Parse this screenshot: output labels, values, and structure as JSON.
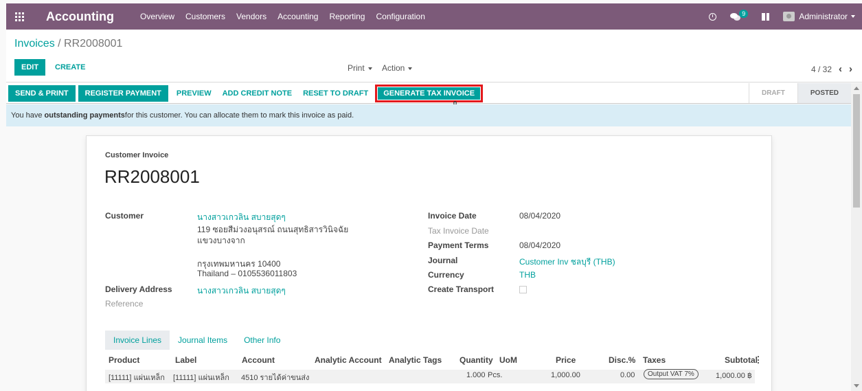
{
  "navbar": {
    "app_title": "Accounting",
    "menu": [
      "Overview",
      "Customers",
      "Vendors",
      "Accounting",
      "Reporting",
      "Configuration"
    ],
    "chat_count": "9",
    "user": "Administrator",
    "bg_color": "#7c5a79"
  },
  "control": {
    "breadcrumb_parent": "Invoices",
    "breadcrumb_sep": " / ",
    "breadcrumb_current": "RR2008001",
    "edit_label": "EDIT",
    "create_label": "CREATE",
    "print_label": "Print",
    "action_label": "Action",
    "pager": "4 / 32"
  },
  "statusbar": {
    "send_print": "SEND & PRINT",
    "register_payment": "REGISTER PAYMENT",
    "preview": "PREVIEW",
    "add_credit_note": "ADD CREDIT NOTE",
    "reset_to_draft": "RESET TO DRAFT",
    "generate_tax_invoice": "GENERATE TAX INVOICE",
    "stages": [
      "DRAFT",
      "POSTED"
    ],
    "active_stage": "POSTED"
  },
  "alert": {
    "prefix": "You have ",
    "bold": "outstanding payments",
    "suffix": " for this customer. You can allocate them to mark this invoice as paid."
  },
  "sheet": {
    "type": "Customer Invoice",
    "number": "RR2008001",
    "customer_label": "Customer",
    "customer_name": "นางสาวเกวลิน สบายสุดๆ",
    "customer_addr1": "119 ซอยสีม่วงอนุสรณ์ ถนนสุทธิสารวินิจฉัย",
    "customer_addr2": "แขวงบางจาก",
    "customer_addr3": "กรุงเทพมหานคร 10400",
    "customer_addr4": "Thailand – 0105536011803",
    "delivery_label": "Delivery Address",
    "delivery_value": "นางสาวเกวลิน สบายสุดๆ",
    "reference_label": "Reference",
    "invoice_date_label": "Invoice Date",
    "invoice_date": "08/04/2020",
    "tax_invoice_date_label": "Tax Invoice Date",
    "payment_terms_label": "Payment Terms",
    "payment_terms": "08/04/2020",
    "journal_label": "Journal",
    "journal": "Customer Inv ชลบุรี (THB)",
    "currency_label": "Currency",
    "currency": "THB",
    "create_transport_label": "Create Transport"
  },
  "tabs": [
    "Invoice Lines",
    "Journal Items",
    "Other Info"
  ],
  "lines": {
    "headers": {
      "product": "Product",
      "label": "Label",
      "account": "Account",
      "analytic_account": "Analytic Account",
      "analytic_tags": "Analytic Tags",
      "quantity": "Quantity",
      "uom": "UoM",
      "price": "Price",
      "disc": "Disc.%",
      "taxes": "Taxes",
      "subtotal": "Subtotal"
    },
    "rows": [
      {
        "product": "[11111] แผ่นเหล็ก",
        "label": "[11111] แผ่นเหล็ก",
        "account": "4510 รายได้ค่าขนส่ง",
        "quantity": "1.000",
        "uom": "Pcs.",
        "price": "1,000.00",
        "disc": "0.00",
        "taxes": "Output VAT 7%",
        "subtotal": "1,000.00 ฿"
      }
    ]
  }
}
